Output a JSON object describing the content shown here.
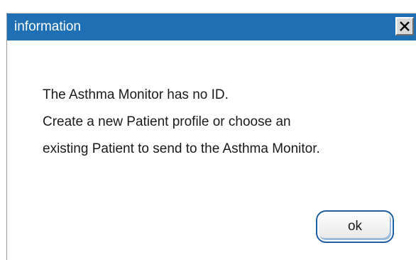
{
  "window": {
    "title": "information",
    "close_icon": "close-icon"
  },
  "message": {
    "lines": [
      "The Asthma Monitor has no ID.",
      "Create a new Patient profile or choose an",
      "existing Patient to send to the Asthma Monitor."
    ]
  },
  "buttons": {
    "ok_label": "ok"
  },
  "colors": {
    "titlebar": "#1f6fb4",
    "title_text": "#ffffff",
    "button_border": "#1f5f9e"
  }
}
